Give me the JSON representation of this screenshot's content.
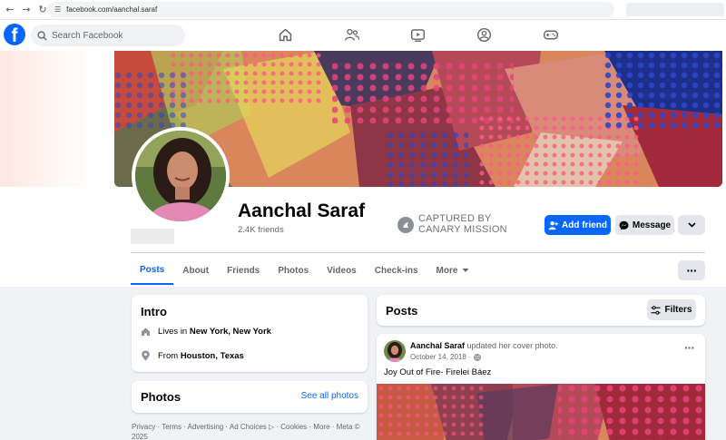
{
  "browser": {
    "url": "facebook.com/aanchal.saraf",
    "back_icon": "←",
    "forward_icon": "→",
    "reload_icon": "↻"
  },
  "topbar": {
    "logo_letter": "f",
    "search_placeholder": "Search Facebook",
    "accent": "#0866ff"
  },
  "profile": {
    "name": "Aanchal Saraf",
    "friends": "2.4K friends",
    "watermark_line1": "CAPTURED BY",
    "watermark_line2": "CANARY MISSION",
    "add_friend_label": "Add friend",
    "message_label": "Message"
  },
  "tabs": [
    "Posts",
    "About",
    "Friends",
    "Photos",
    "Videos",
    "Check-ins",
    "More"
  ],
  "intro": {
    "title": "Intro",
    "lives_prefix": "Lives in ",
    "lives_place": "New York, New York",
    "from_prefix": "From ",
    "from_place": "Houston, Texas"
  },
  "photos": {
    "title": "Photos",
    "see_all": "See all photos"
  },
  "footer": "Privacy · Terms · Advertising · Ad Choices ▷ · Cookies · More · Meta © 2025",
  "posts": {
    "title": "Posts",
    "filters_label": "Filters",
    "post": {
      "author": "Aanchal Saraf",
      "action": " updated her cover photo.",
      "date": "October 14, 2018 ·",
      "caption": "Joy Out of Fire- Firelei Báez",
      "menu": "···"
    }
  },
  "more_dots": "···"
}
